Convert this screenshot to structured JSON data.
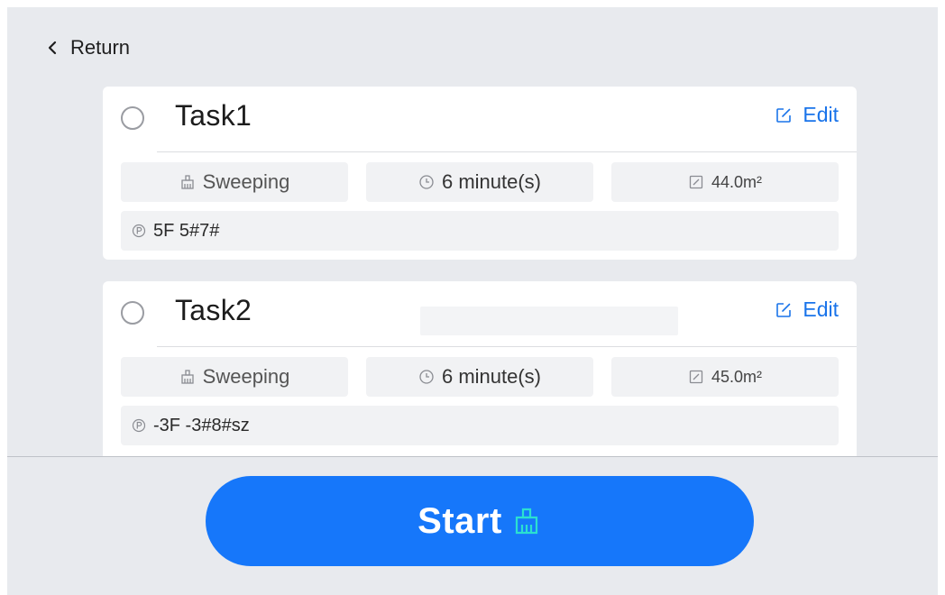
{
  "header": {
    "return_label": "Return"
  },
  "tasks": [
    {
      "name": "Task1",
      "edit_label": "Edit",
      "mode": "Sweeping",
      "duration": "6 minute(s)",
      "area": "44.0m²",
      "location": "5F 5#7#"
    },
    {
      "name": "Task2",
      "edit_label": "Edit",
      "mode": "Sweeping",
      "duration": "6 minute(s)",
      "area": "45.0m²",
      "location": "-3F -3#8#sz"
    }
  ],
  "footer": {
    "start_label": "Start"
  },
  "icons": {
    "return": "chevron-left-icon",
    "edit": "edit-icon",
    "mode": "broom-icon",
    "duration": "clock-icon",
    "area": "area-icon",
    "location": "pin-icon",
    "start": "broom-icon"
  },
  "colors": {
    "accent": "#1677fa",
    "link": "#1a74ea",
    "background": "#e8eaee",
    "card": "#ffffff",
    "chip": "#f1f2f4",
    "start_icon": "#2be0d0"
  }
}
